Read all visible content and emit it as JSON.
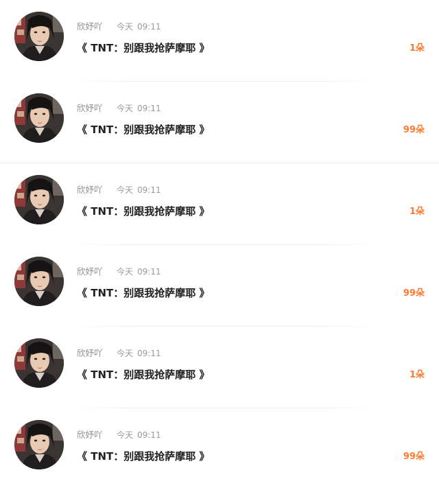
{
  "items": [
    {
      "user": "欣妤吖",
      "date": "今天",
      "time": "09:11",
      "title": "《 TNT：别跟我抢萨摩耶 》",
      "count": "1朵"
    },
    {
      "user": "欣妤吖",
      "date": "今天",
      "time": "09:11",
      "title": "《 TNT：别跟我抢萨摩耶 》",
      "count": "99朵"
    },
    {
      "user": "欣妤吖",
      "date": "今天",
      "time": "09:11",
      "title": "《 TNT：别跟我抢萨摩耶 》",
      "count": "1朵"
    },
    {
      "user": "欣妤吖",
      "date": "今天",
      "time": "09:11",
      "title": "《 TNT：别跟我抢萨摩耶 》",
      "count": "99朵"
    },
    {
      "user": "欣妤吖",
      "date": "今天",
      "time": "09:11",
      "title": "《 TNT：别跟我抢萨摩耶 》",
      "count": "1朵"
    },
    {
      "user": "欣妤吖",
      "date": "今天",
      "time": "09:11",
      "title": "《 TNT：别跟我抢萨摩耶 》",
      "count": "99朵"
    }
  ],
  "colors": {
    "count": "#ff7a2f",
    "title": "#222222",
    "meta": "#999999",
    "divider": "#eeeeee"
  }
}
